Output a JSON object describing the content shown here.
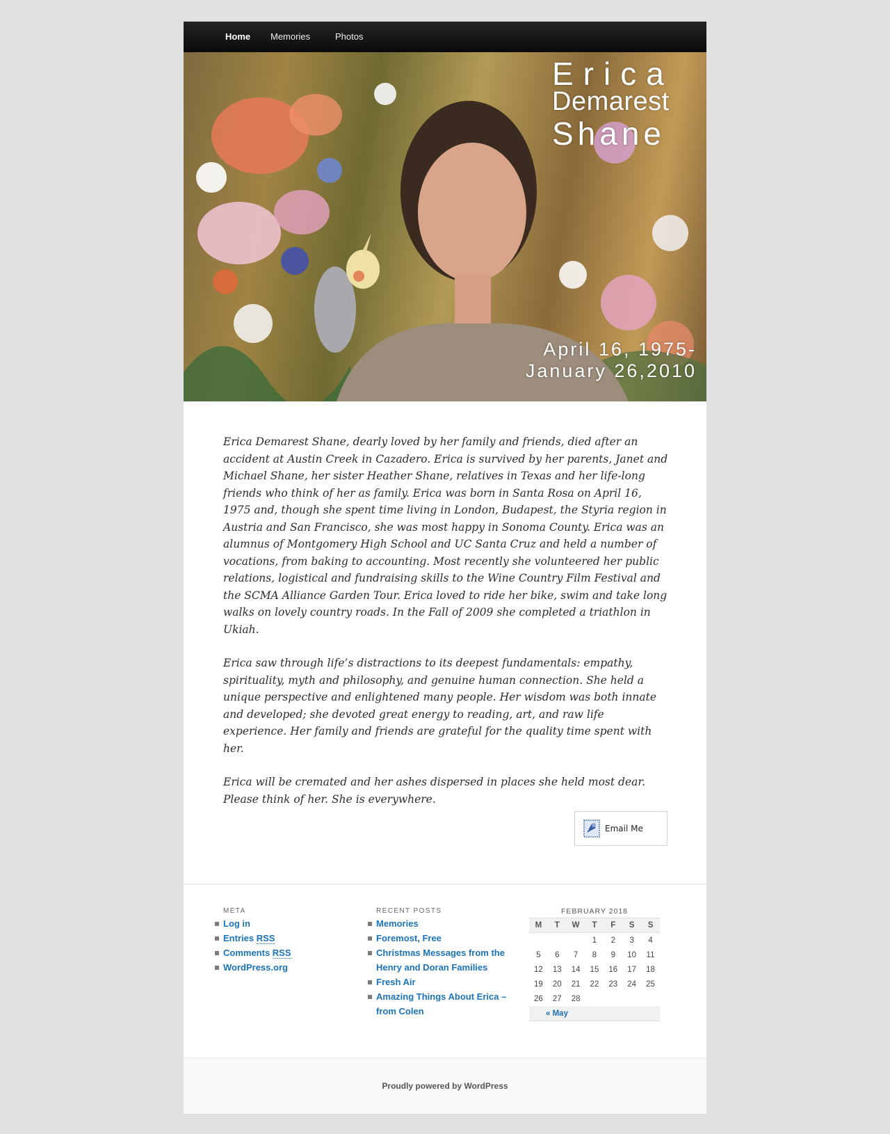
{
  "nav": {
    "items": [
      "Home",
      "Memories",
      "Photos"
    ]
  },
  "header": {
    "name_line1": "Erica",
    "name_line2": "Demarest",
    "name_line3": "Shane",
    "date_line1": "April 16, 1975-",
    "date_line2": "January 26,2010"
  },
  "content": {
    "paragraphs": [
      "Erica Demarest Shane, dearly loved by her family and friends, died after an accident at Austin Creek in Cazadero. Erica is survived by her parents, Janet and Michael Shane, her sister Heather Shane, relatives in Texas and her life-long friends who think of her as family. Erica was born in Santa Rosa on April 16, 1975 and, though she spent time living in London, Budapest, the Styria region in Austria and San Francisco, she was most happy in Sonoma County. Erica was an alumnus of Montgomery High School and UC Santa Cruz and held a number of vocations, from baking to accounting. Most recently she volunteered her public relations, logistical and fundraising skills to the Wine Country Film Festival and the SCMA Alliance Garden Tour. Erica loved to ride her bike, swim and take long walks on lovely country roads. In the Fall of 2009 she completed a triathlon in Ukiah.",
      "Erica saw through life’s distractions to its deepest fundamentals: empathy, spirituality, myth and philosophy, and genuine human connection. She held a unique perspective and enlightened many people. Her wisdom was both innate and developed; she devoted great energy to reading, art, and raw life experience. Her family and friends are grateful for the quality time spent with her.",
      "Erica will be cremated and her ashes dispersed in places she held most dear. Please think of her. She is everywhere."
    ],
    "email_button_label": "Email Me"
  },
  "meta": {
    "title": "META",
    "log_in": "Log in",
    "entries_prefix": "Entries ",
    "comments_prefix": "Comments ",
    "rss": "RSS",
    "wordpress_org": "WordPress.org"
  },
  "recent_posts": {
    "title": "RECENT POSTS",
    "items": [
      "Memories",
      "Foremost, Free",
      "Christmas Messages from the Henry and Doran Families",
      "Fresh Air",
      "Amazing Things About Erica – from Colen"
    ]
  },
  "calendar": {
    "caption": "FEBRUARY 2018",
    "weekdays": [
      "M",
      "T",
      "W",
      "T",
      "F",
      "S",
      "S"
    ],
    "weeks": [
      [
        "",
        "",
        "",
        "1",
        "2",
        "3",
        "4"
      ],
      [
        "5",
        "6",
        "7",
        "8",
        "9",
        "10",
        "11"
      ],
      [
        "12",
        "13",
        "14",
        "15",
        "16",
        "17",
        "18"
      ],
      [
        "19",
        "20",
        "21",
        "22",
        "23",
        "24",
        "25"
      ],
      [
        "26",
        "27",
        "28",
        "",
        "",
        "",
        ""
      ]
    ],
    "prev_link": "« May"
  },
  "footer": {
    "credit": "Proudly powered by WordPress"
  },
  "colors": {
    "link": "#1b73ba",
    "page_bg": "#e2e2e2",
    "nav_bg": "#111111"
  }
}
